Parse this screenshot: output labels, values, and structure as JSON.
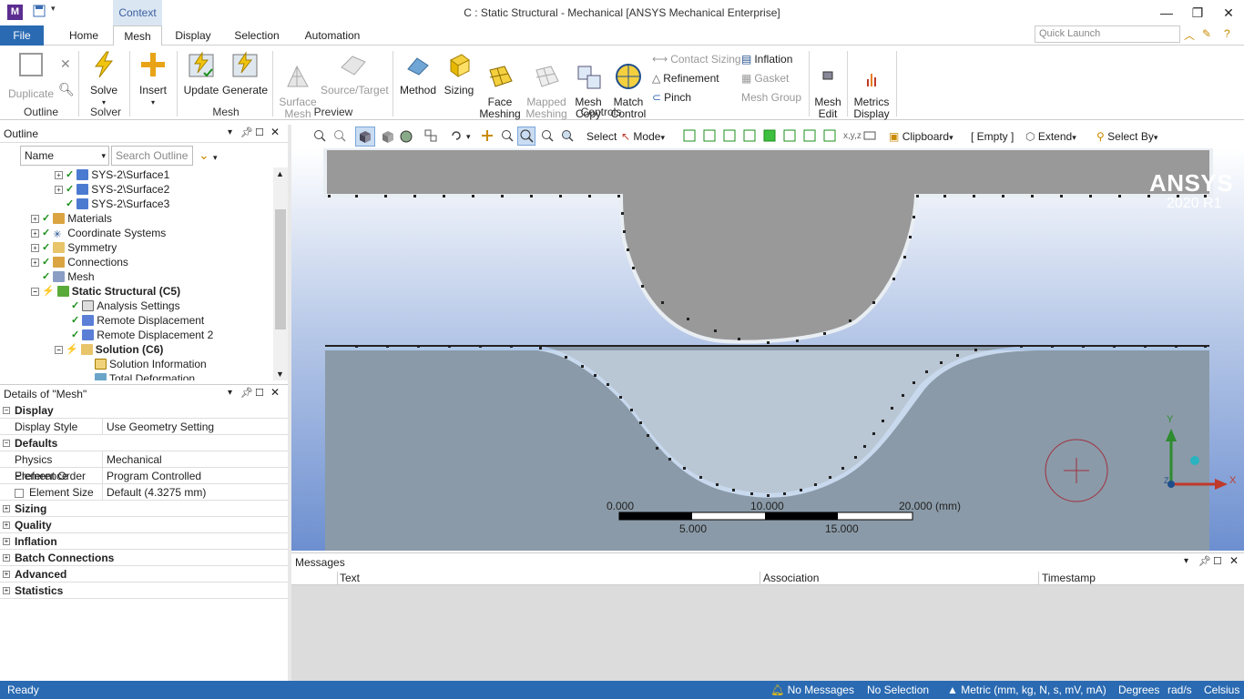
{
  "app": {
    "title": "C : Static Structural - Mechanical [ANSYS Mechanical Enterprise]",
    "context_tab": "Context"
  },
  "tabs": [
    "File",
    "Home",
    "Mesh",
    "Display",
    "Selection",
    "Automation"
  ],
  "quick_launch": {
    "placeholder": "Quick Launch"
  },
  "ribbon": {
    "outline_group": {
      "duplicate": "Duplicate",
      "label": "Outline"
    },
    "solver_group": {
      "solve": "Solve",
      "label": "Solver"
    },
    "insert": "Insert",
    "mesh_group": {
      "update": "Update",
      "generate": "Generate",
      "label": "Mesh"
    },
    "preview_group": {
      "surface_mesh": "Surface\nMesh",
      "source_target": "Source/Target",
      "label": "Preview"
    },
    "controls_group": {
      "method": "Method",
      "sizing": "Sizing",
      "face_meshing": "Face\nMeshing",
      "mapped_meshing": "Mapped\nMeshing",
      "mesh_copy": "Mesh\nCopy",
      "match_control": "Match\nControl",
      "label": "Controls"
    },
    "small": {
      "contact_sizing": "Contact Sizing",
      "refinement": "Refinement",
      "pinch": "Pinch",
      "inflation": "Inflation",
      "gasket": "Gasket",
      "mesh_group": "Mesh Group"
    },
    "mesh_edit": "Mesh\nEdit",
    "metrics_display": "Metrics\nDisplay"
  },
  "toolbar": {
    "select": "Select",
    "mode": "Mode",
    "clipboard": "Clipboard",
    "empty": "[ Empty ]",
    "extend": "Extend",
    "select_by": "Select By"
  },
  "outline": {
    "title": "Outline",
    "name_combo": "Name",
    "search_placeholder": "Search Outline",
    "items": [
      {
        "label": "SYS-2\\Surface1"
      },
      {
        "label": "SYS-2\\Surface2"
      },
      {
        "label": "SYS-2\\Surface3"
      },
      {
        "label": "Materials"
      },
      {
        "label": "Coordinate Systems"
      },
      {
        "label": "Symmetry"
      },
      {
        "label": "Connections"
      },
      {
        "label": "Mesh"
      },
      {
        "label": "Static Structural (C5)"
      },
      {
        "label": "Analysis Settings"
      },
      {
        "label": "Remote Displacement"
      },
      {
        "label": "Remote Displacement 2"
      },
      {
        "label": "Solution (C6)"
      },
      {
        "label": "Solution Information"
      },
      {
        "label": "Total Deformation"
      }
    ]
  },
  "details": {
    "title": "Details of \"Mesh\"",
    "display_section": "Display",
    "display_style_key": "Display Style",
    "display_style_val": "Use Geometry Setting",
    "defaults_section": "Defaults",
    "physics_key": "Physics Preference",
    "physics_val": "Mechanical",
    "order_key": "Element Order",
    "order_val": "Program Controlled",
    "size_key": "Element Size",
    "size_val": "Default (4.3275 mm)",
    "sections": [
      "Sizing",
      "Quality",
      "Inflation",
      "Batch Connections",
      "Advanced",
      "Statistics"
    ]
  },
  "viewport": {
    "logo": "ANSYS",
    "version": "2020 R1",
    "scale": {
      "t0": "0.000",
      "t10": "10.000",
      "t20": "20.000 (mm)",
      "t5": "5.000",
      "t15": "15.000"
    },
    "axis_y": "Y",
    "axis_x": "X",
    "axis_z": "Z"
  },
  "messages": {
    "title": "Messages",
    "col_text": "Text",
    "col_assoc": "Association",
    "col_time": "Timestamp"
  },
  "status": {
    "ready": "Ready",
    "messages": "No Messages",
    "selection": "No Selection",
    "units": "Metric (mm, kg, N, s, mV, mA)",
    "degrees": "Degrees",
    "rads": "rad/s",
    "temp": "Celsius"
  },
  "colors": {
    "accent": "#2a6ab2",
    "mesh_gray": "#999999",
    "status_bar": "#2a6ab2"
  }
}
